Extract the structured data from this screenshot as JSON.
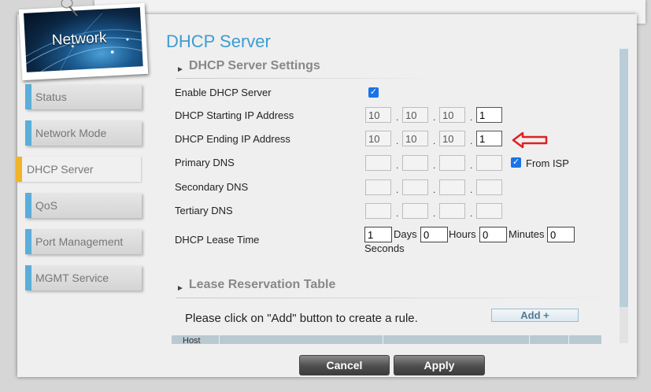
{
  "badge": {
    "title": "Network"
  },
  "sidebar": {
    "items": [
      {
        "label": "Status"
      },
      {
        "label": "Network Mode"
      },
      {
        "label": "DHCP Server"
      },
      {
        "label": "QoS"
      },
      {
        "label": "Port Management"
      },
      {
        "label": "MGMT Service"
      }
    ],
    "active_index": 2
  },
  "page": {
    "title": "DHCP Server"
  },
  "settings": {
    "section_title": "DHCP Server Settings",
    "enable": {
      "label": "Enable DHCP Server",
      "checked": true
    },
    "start_ip": {
      "label": "DHCP Starting IP Address",
      "octets": [
        "10",
        "10",
        "10",
        "1"
      ]
    },
    "end_ip": {
      "label": "DHCP Ending IP Address",
      "octets": [
        "10",
        "10",
        "10",
        "1"
      ]
    },
    "primary_dns": {
      "label": "Primary DNS",
      "octets": [
        "",
        "",
        "",
        ""
      ],
      "from_isp_label": "From ISP",
      "from_isp_checked": true
    },
    "secondary_dns": {
      "label": "Secondary DNS",
      "octets": [
        "",
        "",
        "",
        ""
      ]
    },
    "tertiary_dns": {
      "label": "Tertiary DNS",
      "octets": [
        "",
        "",
        "",
        ""
      ]
    },
    "lease": {
      "label": "DHCP Lease Time",
      "days": "1",
      "days_unit": "Days",
      "hours": "0",
      "hours_unit": "Hours",
      "minutes": "0",
      "minutes_unit": "Minutes",
      "seconds": "0",
      "seconds_unit": "Seconds"
    }
  },
  "reservation": {
    "section_title": "Lease Reservation Table",
    "info": "Please click on \"Add\" button to create a rule.",
    "add_label": "Add +",
    "columns": [
      "Host",
      "",
      "",
      "",
      ""
    ]
  },
  "footer": {
    "cancel_label": "Cancel",
    "apply_label": "Apply"
  },
  "colors": {
    "accent": "#3d9cd2",
    "active_marker": "#f0b429",
    "arrow": "#e02020"
  }
}
